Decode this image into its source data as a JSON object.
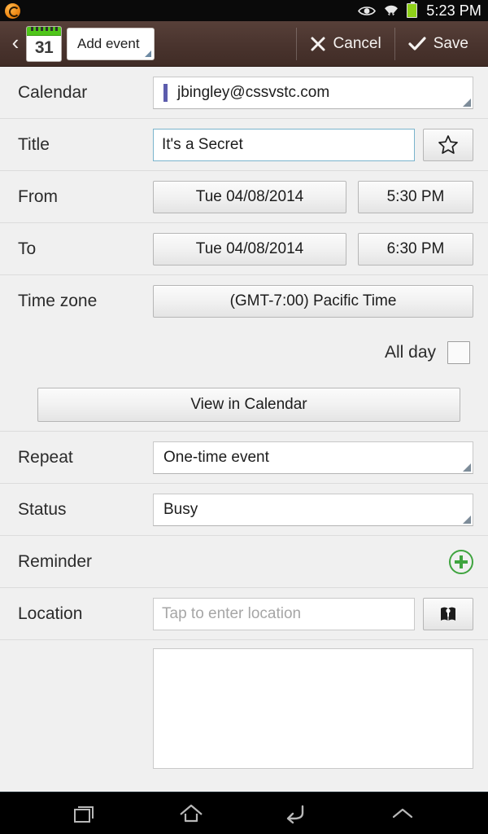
{
  "statusbar": {
    "time": "5:23 PM",
    "icons": [
      "eye-icon",
      "wifi-icon",
      "battery-icon"
    ]
  },
  "actionbar": {
    "back_icon": "back-chevron-icon",
    "app_icon": "calendar-icon",
    "app_icon_day": "31",
    "spinner_label": "Add event",
    "cancel_label": "Cancel",
    "cancel_icon": "close-icon",
    "save_label": "Save",
    "save_icon": "checkmark-icon"
  },
  "form": {
    "calendar": {
      "label": "Calendar",
      "value": "jbingley@cssvstc.com",
      "color": "#5c5cad"
    },
    "title": {
      "label": "Title",
      "value": "It's a Secret",
      "favorite_icon": "star-icon"
    },
    "from": {
      "label": "From",
      "date": "Tue 04/08/2014",
      "time": "5:30 PM"
    },
    "to": {
      "label": "To",
      "date": "Tue 04/08/2014",
      "time": "6:30 PM"
    },
    "timezone": {
      "label": "Time zone",
      "value": "(GMT-7:00) Pacific Time"
    },
    "all_day": {
      "label": "All day",
      "checked": false
    },
    "view_in_calendar": {
      "label": "View in Calendar"
    },
    "repeat": {
      "label": "Repeat",
      "value": "One-time event"
    },
    "status": {
      "label": "Status",
      "value": "Busy"
    },
    "reminder": {
      "label": "Reminder",
      "add_icon": "plus-circle-icon"
    },
    "location": {
      "label": "Location",
      "value": "",
      "placeholder": "Tap to enter location",
      "map_icon": "map-icon"
    },
    "description": {
      "value": ""
    }
  },
  "navbar": {
    "recents_icon": "recents-icon",
    "home_icon": "home-icon",
    "back_icon": "back-arrow-icon",
    "expand_icon": "chevron-up-icon"
  },
  "colors": {
    "actionbar": "#4a342e",
    "accent_green": "#3fa43f",
    "focus_blue": "#7ab4cc",
    "background": "#f0f0f0"
  }
}
